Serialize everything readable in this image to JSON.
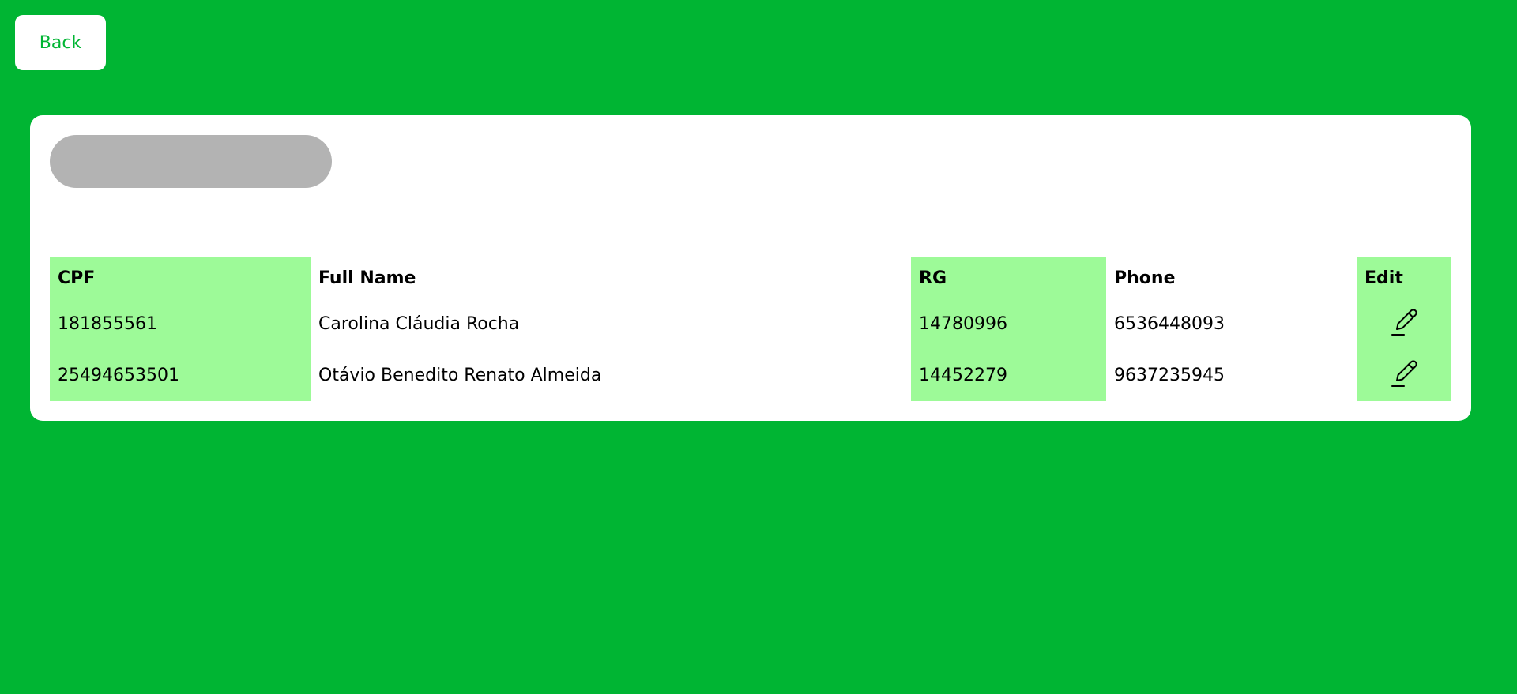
{
  "back_button": {
    "label": "Back"
  },
  "table": {
    "headers": {
      "cpf": "CPF",
      "full_name": "Full Name",
      "rg": "RG",
      "phone": "Phone",
      "edit": "Edit"
    },
    "rows": [
      {
        "cpf": "181855561",
        "full_name": "Carolina Cláudia Rocha",
        "rg": "14780996",
        "phone": "6536448093",
        "edit_icon": "pencil-icon"
      },
      {
        "cpf": "25494653501",
        "full_name": "Otávio Benedito Renato Almeida",
        "rg": "14452279",
        "phone": "9637235945",
        "edit_icon": "pencil-icon"
      }
    ]
  },
  "colors": {
    "background": "#00b533",
    "card": "#ffffff",
    "highlight_column": "#9dfa98",
    "placeholder_pill": "#b3b3b3",
    "back_text": "#00b533"
  }
}
